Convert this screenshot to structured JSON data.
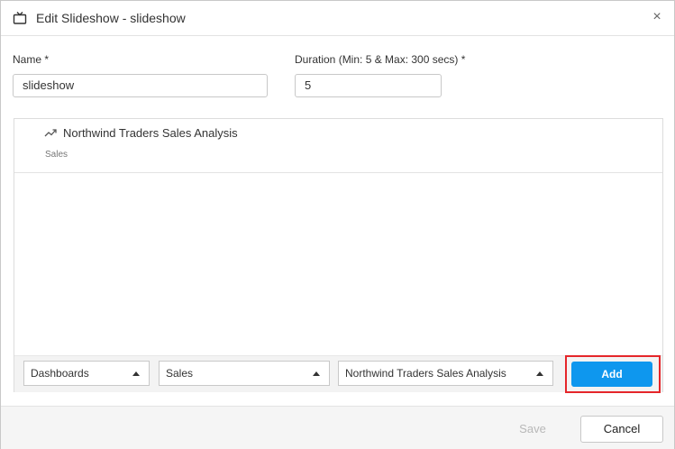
{
  "dialog": {
    "title": "Edit Slideshow - slideshow",
    "close_symbol": "×"
  },
  "form": {
    "name_label": "Name *",
    "name_value": "slideshow",
    "duration_label": "Duration (Min: 5 & Max: 300 secs) *",
    "duration_value": "5"
  },
  "slideshow_items": [
    {
      "title": "Northwind Traders Sales Analysis",
      "subtitle": "Sales",
      "icon": "trending-up-icon"
    }
  ],
  "selectors": {
    "type": "Dashboards",
    "category": "Sales",
    "item": "Northwind Traders Sales Analysis",
    "add_label": "Add"
  },
  "footer": {
    "save_label": "Save",
    "cancel_label": "Cancel"
  },
  "colors": {
    "accent": "#0e97ee",
    "highlight_border": "#e5262a"
  }
}
